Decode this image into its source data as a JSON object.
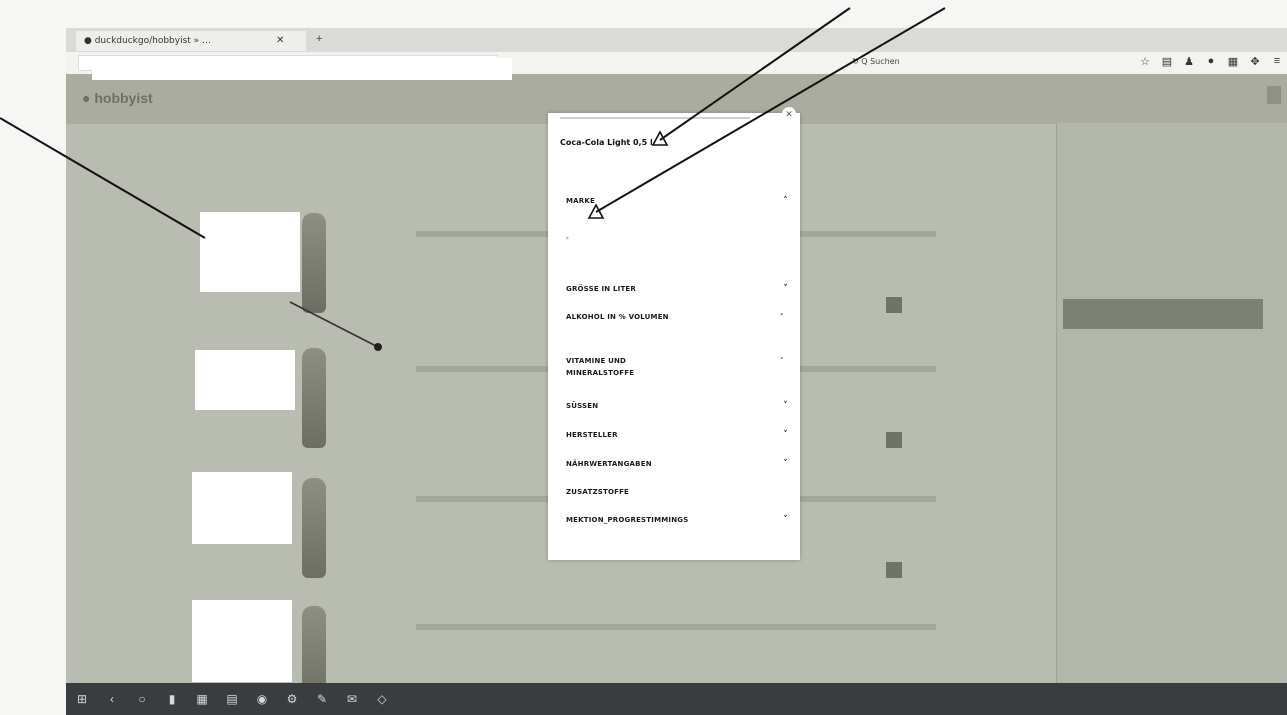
{
  "browser": {
    "tab_label": "● duckduckgo/hobbyist » …",
    "tab_close": "✕",
    "new_tab": "+",
    "url_suffix": "↻  Q Suchen",
    "toolbar_icons": [
      "star-icon",
      "bookmark-icon",
      "bell-icon",
      "circle-icon",
      "reader-icon",
      "extension-icon",
      "menu-icon"
    ]
  },
  "site": {
    "logo": "● hobbyist"
  },
  "popup": {
    "close": "✕",
    "title": "Coca-Cola Light 0,5 l",
    "filters": [
      {
        "label": "MARKE",
        "chevron": "˄"
      },
      {
        "label": "GRÖSSE IN LITER",
        "chevron": "˅"
      },
      {
        "label": "ALKOHOL IN % VOLUMEN",
        "chevron": "˅"
      },
      {
        "label": "VITAMINE UND MINERALSTOFFE",
        "chevron": "˅"
      },
      {
        "label": "SÜSSEN",
        "chevron": "˅"
      },
      {
        "label": "HERSTELLER",
        "chevron": "˅"
      },
      {
        "label": "NÄHRWERTANGABEN",
        "chevron": "˅"
      },
      {
        "label": "ZUSATZSTOFFE",
        "chevron": ""
      },
      {
        "label": "MEKTION_PROGRESTIMMINGS",
        "chevron": "˅"
      }
    ]
  },
  "taskbar": {
    "icons": [
      "start-icon",
      "back-icon",
      "search-icon",
      "files-icon",
      "calendar-icon",
      "clipboard-icon",
      "browser-icon",
      "settings-icon",
      "edit-icon",
      "mail-icon",
      "app-icon"
    ]
  },
  "colors": {
    "overlay": "#b9bcb1",
    "popup_bg": "#ffffff",
    "annotation": "#111111"
  }
}
